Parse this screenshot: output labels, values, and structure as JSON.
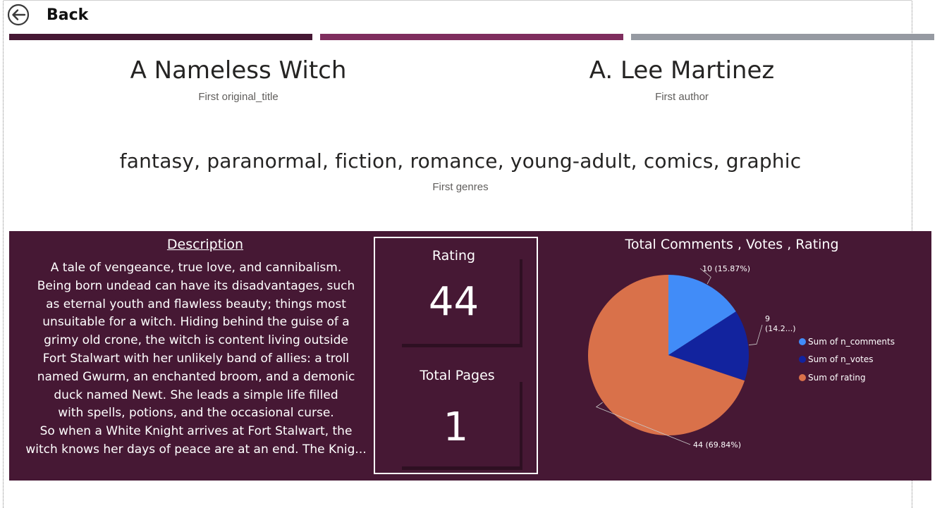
{
  "nav": {
    "back_label": "Back"
  },
  "header_bars": {
    "colors": [
      "#461834",
      "#7f2e5e",
      "#969aa2"
    ]
  },
  "cards": {
    "original_title": {
      "value": "A Nameless Witch",
      "label": "First original_title"
    },
    "author": {
      "value": "A. Lee Martinez",
      "label": "First author"
    },
    "genres": {
      "value": "fantasy, paranormal, fiction, romance, young-adult, comics, graphic",
      "label": "First genres"
    }
  },
  "description": {
    "title": "Description",
    "lines": [
      "A tale of vengeance, true love, and cannibalism.",
      "Being born undead can have its disadvantages, such",
      "as eternal youth and flawless beauty; things most",
      "unsuitable for a witch. Hiding behind the guise of a",
      "grimy old crone, the witch is content living outside",
      "Fort Stalwart with her unlikely band of allies: a troll",
      "named Gwurm, an enchanted broom, and a demonic",
      "duck named Newt. She leads a simple life filled",
      "with spells, potions, and the occasional curse.",
      "So when a White Knight arrives at Fort Stalwart, the",
      "witch knows her days of peace are at an end. The Knig..."
    ]
  },
  "kpis": {
    "rating": {
      "label": "Rating",
      "value": "44"
    },
    "total_pages": {
      "label": "Total Pages",
      "value": "1"
    }
  },
  "colors": {
    "panel_background": "#461834",
    "text": "#ffffff"
  },
  "chart_data": {
    "type": "pie",
    "title": "Total Comments , Votes , Rating",
    "categories": [
      "Sum of n_comments",
      "Sum of n_votes",
      "Sum of rating"
    ],
    "values": [
      10,
      9,
      44
    ],
    "data_labels": [
      "10 (15.87%)",
      "9 (14.2...)",
      "44 (69.84%)"
    ],
    "colors": [
      "#418cf8",
      "#12239e",
      "#d9714a"
    ],
    "legend_position": "right"
  }
}
